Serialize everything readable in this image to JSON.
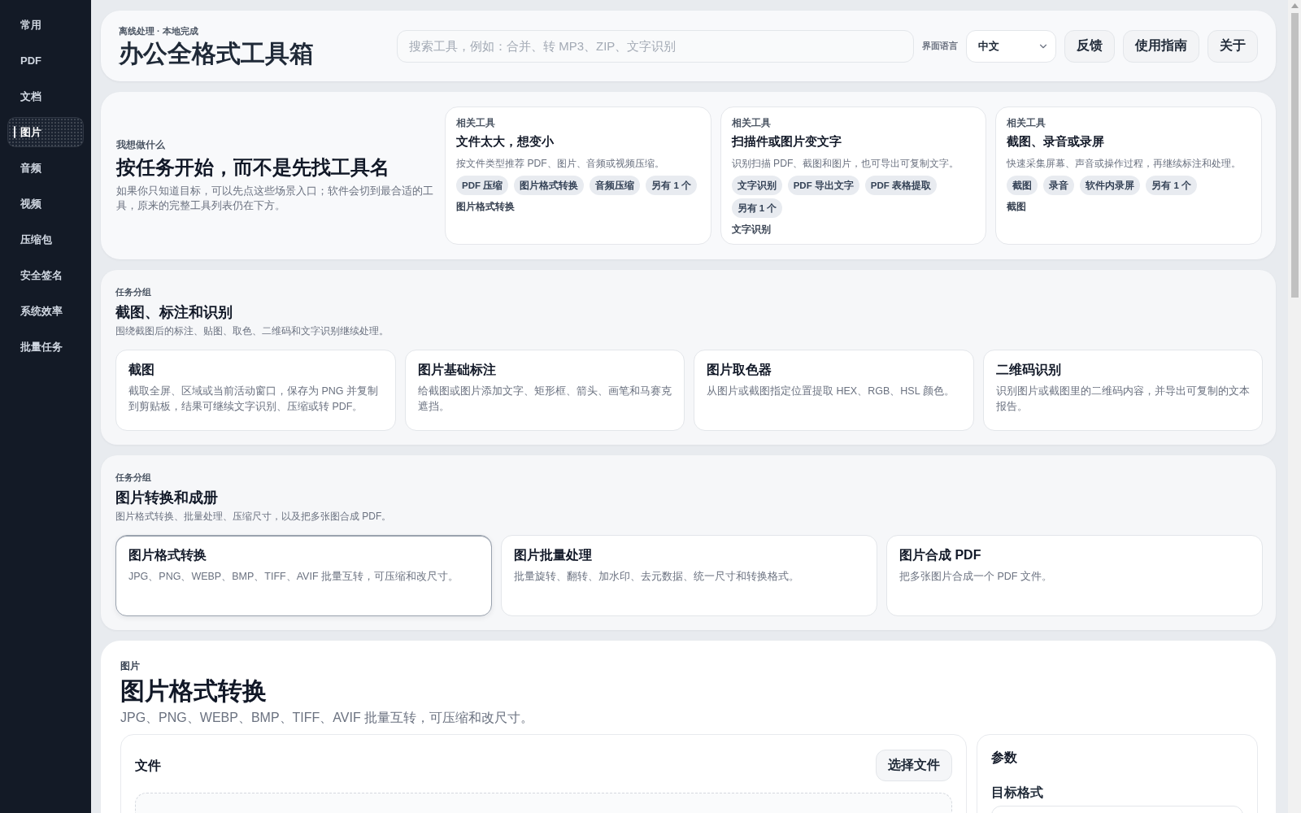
{
  "sidebar": {
    "items": [
      {
        "label": "常用",
        "selected": false
      },
      {
        "label": "PDF",
        "selected": false
      },
      {
        "label": "文档",
        "selected": false
      },
      {
        "label": "图片",
        "selected": true
      },
      {
        "label": "音频",
        "selected": false
      },
      {
        "label": "视频",
        "selected": false
      },
      {
        "label": "压缩包",
        "selected": false
      },
      {
        "label": "安全签名",
        "selected": false
      },
      {
        "label": "系统效率",
        "selected": false
      },
      {
        "label": "批量任务",
        "selected": false
      }
    ]
  },
  "header": {
    "eyebrow": "离线处理 · 本地完成",
    "title": "办公全格式工具箱",
    "search": {
      "placeholder": "搜索工具，例如：合并、转 MP3、ZIP、文字识别"
    },
    "language": {
      "label": "界面语言",
      "value": "中文"
    },
    "buttons": [
      "反馈",
      "使用指南",
      "关于"
    ]
  },
  "intro": {
    "eyebrow": "我想做什么",
    "title": "按任务开始，而不是先找工具名",
    "description": "如果你只知道目标，可以先点这些场景入口；软件会切到最合适的工具，原来的完整工具列表仍在下方。"
  },
  "scenarios": [
    {
      "eyebrow": "相关工具",
      "title": "文件太大，想变小",
      "description": "按文件类型推荐 PDF、图片、音频或视频压缩。",
      "tags": [
        "PDF 压缩",
        "图片格式转换",
        "音频压缩",
        "另有 1 个"
      ],
      "link": "图片格式转换"
    },
    {
      "eyebrow": "相关工具",
      "title": "扫描件或图片变文字",
      "description": "识别扫描 PDF、截图和图片，也可导出可复制文字。",
      "tags": [
        "文字识别",
        "PDF 导出文字",
        "PDF 表格提取",
        "另有 1 个"
      ],
      "link": "文字识别"
    },
    {
      "eyebrow": "相关工具",
      "title": "截图、录音或录屏",
      "description": "快速采集屏幕、声音或操作过程，再继续标注和处理。",
      "tags": [
        "截图",
        "录音",
        "软件内录屏",
        "另有 1 个"
      ],
      "link": "截图"
    }
  ],
  "groups": [
    {
      "eyebrow": "任务分组",
      "title": "截图、标注和识别",
      "description": "围绕截图后的标注、贴图、取色、二维码和文字识别继续处理。",
      "tools": [
        {
          "name": "截图",
          "description": "截取全屏、区域或当前活动窗口，保存为 PNG 并复制到剪贴板，结果可继续文字识别、压缩或转 PDF。",
          "selected": false
        },
        {
          "name": "图片基础标注",
          "description": "给截图或图片添加文字、矩形框、箭头、画笔和马赛克遮挡。",
          "selected": false
        },
        {
          "name": "图片取色器",
          "description": "从图片或截图指定位置提取 HEX、RGB、HSL 颜色。",
          "selected": false
        },
        {
          "name": "二维码识别",
          "description": "识别图片或截图里的二维码内容，并导出可复制的文本报告。",
          "selected": false
        }
      ]
    },
    {
      "eyebrow": "任务分组",
      "title": "图片转换和成册",
      "description": "图片格式转换、批量处理、压缩尺寸，以及把多张图合成 PDF。",
      "tools": [
        {
          "name": "图片格式转换",
          "description": "JPG、PNG、WEBP、BMP、TIFF、AVIF 批量互转，可压缩和改尺寸。",
          "selected": true
        },
        {
          "name": "图片批量处理",
          "description": "批量旋转、翻转、加水印、去元数据、统一尺寸和转换格式。",
          "selected": false
        },
        {
          "name": "图片合成 PDF",
          "description": "把多张图片合成一个 PDF 文件。",
          "selected": false
        }
      ]
    }
  ],
  "tool_panel": {
    "category": "图片",
    "title": "图片格式转换",
    "description": "JPG、PNG、WEBP、BMP、TIFF、AVIF 批量互转，可压缩和改尺寸。",
    "files": {
      "title": "文件",
      "button": "选择文件"
    },
    "params": {
      "title": "参数",
      "fields": [
        {
          "label": "目标格式"
        }
      ]
    }
  }
}
